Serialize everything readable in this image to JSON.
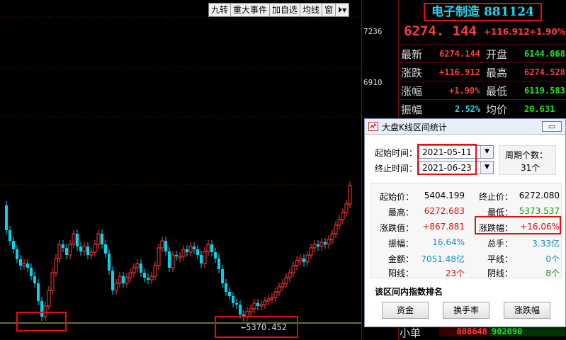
{
  "toolbar": {
    "buttons": [
      "九转",
      "重大事件",
      "加自选",
      "均线",
      "窗",
      "⏵▾"
    ]
  },
  "price_axis": {
    "ticks": [
      "7236",
      "6910"
    ]
  },
  "chart": {
    "low_marker": "←5370.452"
  },
  "stock": {
    "title": "电子制造 881124",
    "price": "6274. 144",
    "change_pts": "+116.912",
    "change_pct": "+1.90%"
  },
  "quote_rows": [
    {
      "label": "最新",
      "value": "6274.144",
      "label2": "开盘",
      "value2": "6144.068"
    },
    {
      "label": "涨跌",
      "value": "+116.912",
      "label2": "最高",
      "value2": "6274.528"
    },
    {
      "label": "涨幅",
      "value": "+1.90%",
      "label2": "最低",
      "value2": "6119.583"
    },
    {
      "label": "振幅",
      "value": "2.52%",
      "label2": "均价",
      "value2": "20.631"
    }
  ],
  "bottom_row": {
    "label": "小单",
    "value1": "808648",
    "value2": "902090"
  },
  "dialog": {
    "title": "大盘K线区间统计",
    "close_label": "▭",
    "start_label": "起始时间：",
    "start_value": "2021-05-11",
    "end_label": "终止时间：",
    "end_value": "2021-06-23",
    "period_label": "周期个数：",
    "period_value": "31个",
    "stats": {
      "start_price_label": "起始价：",
      "start_price": "5404.199",
      "end_price_label": "终止价：",
      "end_price": "6272.080",
      "high_label": "最高：",
      "high": "6272.683",
      "low_label": "最低：",
      "low": "5373.537",
      "change_label": "涨跌值：",
      "change": "+867.881",
      "change_pct_label": "涨跌幅：",
      "change_pct": "+16.06%",
      "amplitude_label": "振幅：",
      "amplitude": "16.64%",
      "turnover_label": "总手：",
      "turnover": "3.33亿",
      "amount_label": "金额：",
      "amount": "7051.48亿",
      "flat_label": "平线：",
      "flat": "0个",
      "up_label": "阳线：",
      "up": "23个",
      "down_label": "阴线：",
      "down": "8个"
    },
    "section_label": "该区间内指数排名",
    "buttons": [
      "资金",
      "换手率",
      "涨跌幅"
    ]
  },
  "colors": {
    "up": "#ff3b3b",
    "down": "#22e022",
    "title": "#21d4ef",
    "highlight_box": "#e01010"
  }
}
